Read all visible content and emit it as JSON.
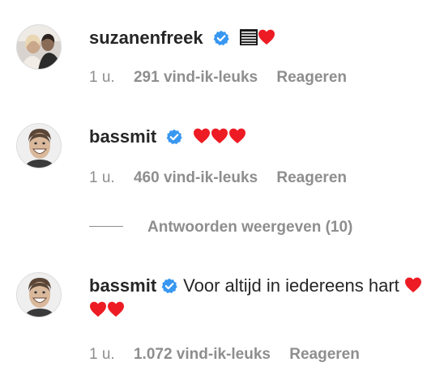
{
  "comments": [
    {
      "username": "suzanenfreek",
      "verified": true,
      "text": "",
      "emoji": [
        "list-icon",
        "heart"
      ],
      "time": "1 u.",
      "likes": "291 vind-ik-leuks",
      "reply": "Reageren",
      "avatar": "couple-avatar"
    },
    {
      "username": "bassmit",
      "verified": true,
      "text": "",
      "emoji": [
        "heart",
        "heart",
        "heart"
      ],
      "time": "1 u.",
      "likes": "460 vind-ik-leuks",
      "reply": "Reageren",
      "avatar": "man-avatar"
    },
    {
      "username": "bassmit",
      "verified": true,
      "text": "Voor altijd in iedereens hart",
      "emoji": [
        "heart",
        "heart",
        "heart"
      ],
      "time": "1 u.",
      "likes": "1.072 vind-ik-leuks",
      "reply": "Reageren",
      "avatar": "man-avatar"
    }
  ],
  "view_replies": "Antwoorden weergeven (10)",
  "colors": {
    "text": "#262626",
    "muted": "#8e8e8e",
    "verified": "#3897f0",
    "heart": "#ed1c24"
  }
}
